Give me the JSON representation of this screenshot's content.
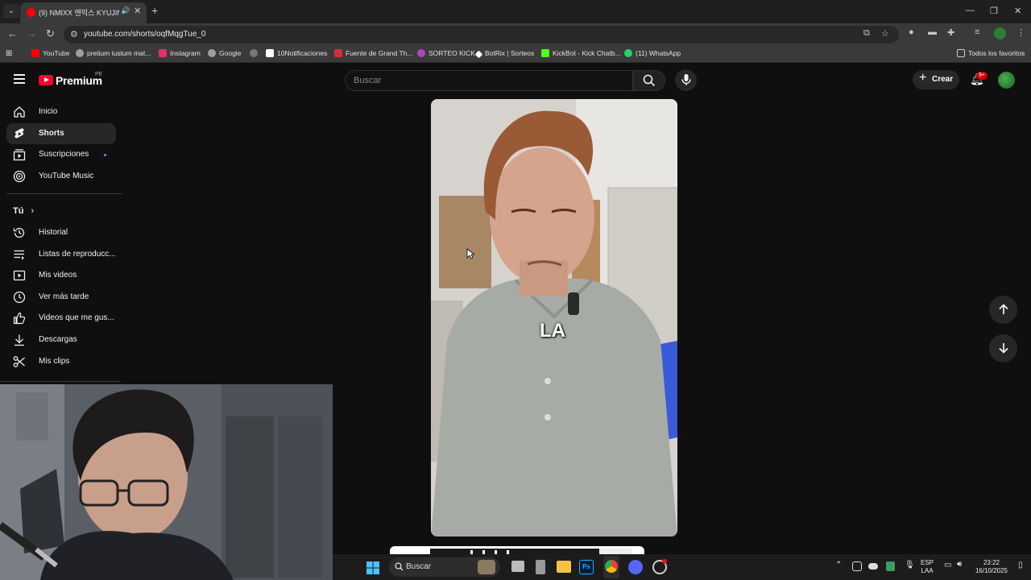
{
  "browser": {
    "tab_title": "(9) NMIXX 엔믹스 KYUJIN F",
    "url": "youtube.com/shorts/oqfMqgTue_0",
    "bookmarks": [
      {
        "label": "YouTube",
        "color": "#ff0000"
      },
      {
        "label": "pretium iustum mat...",
        "color": "#9aa0a6"
      },
      {
        "label": "Instagram",
        "color": "#e1306c"
      },
      {
        "label": "Google",
        "color": "#9aa0a6"
      },
      {
        "label": "",
        "color": "#9aa0a6"
      },
      {
        "label": "10Notificaciones",
        "color": "#ffffff"
      },
      {
        "label": "Fuente de Grand Th...",
        "color": "#d32f2f"
      },
      {
        "label": "SORTEO KICK",
        "color": "#ab47bc"
      },
      {
        "label": "BotRix | Sorteos",
        "color": "#ffffff"
      },
      {
        "label": "KickBot - Kick Chatb...",
        "color": "#53fc18"
      },
      {
        "label": "(11) WhatsApp",
        "color": "#25d366"
      }
    ],
    "all_bookmarks": "Todos los favoritos"
  },
  "youtube": {
    "brand": "Premium",
    "country": "PE",
    "search_placeholder": "Buscar",
    "create_label": "Crear",
    "notifications_badge": "9+",
    "sidebar": {
      "main": [
        {
          "label": "Inicio",
          "icon": "home-icon"
        },
        {
          "label": "Shorts",
          "icon": "shorts-icon",
          "active": true
        },
        {
          "label": "Suscripciones",
          "icon": "subscriptions-icon",
          "dot": true
        },
        {
          "label": "YouTube Music",
          "icon": "music-icon"
        }
      ],
      "you_heading": "Tú",
      "you": [
        {
          "label": "Historial",
          "icon": "history-icon"
        },
        {
          "label": "Listas de reproducc...",
          "icon": "playlists-icon"
        },
        {
          "label": "Mis videos",
          "icon": "my-videos-icon"
        },
        {
          "label": "Ver más tarde",
          "icon": "watch-later-icon"
        },
        {
          "label": "Videos que me gus...",
          "icon": "like-icon"
        },
        {
          "label": "Descargas",
          "icon": "downloads-icon"
        },
        {
          "label": "Mis clips",
          "icon": "clips-icon"
        }
      ]
    },
    "video_caption": "LA"
  },
  "taskbar": {
    "search_label": "Buscar",
    "language": "ESP",
    "language_sub": "LAA",
    "time": "23:22",
    "date": "16/10/2025"
  }
}
